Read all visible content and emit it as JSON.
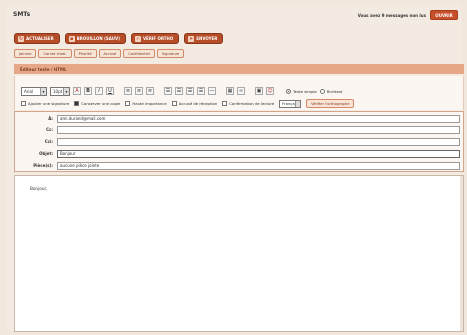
{
  "header": {
    "brand": "SMTs",
    "notice": "Vous avez 9 messages non lus",
    "notice_button": "OUVRIR"
  },
  "actions": [
    {
      "label": "ACTUALISER",
      "icon": "refresh-icon"
    },
    {
      "label": "BROUILLON (SAUV)",
      "icon": "save-icon"
    },
    {
      "label": "VÉRIF ORTHO",
      "icon": "spellcheck-icon"
    },
    {
      "label": "ENVOYER",
      "icon": "send-icon"
    }
  ],
  "tabs": [
    "Joindre",
    "Carnet d'adr.",
    "Priorité",
    "Accusé",
    "Confidentiel",
    "Signature"
  ],
  "editor": {
    "header_label": "Éditeur texte / HTML",
    "font_family": "Arial",
    "font_size": "10pt",
    "radio_text": "Texte simple",
    "radio_html": "Richtext",
    "checkbox_signature": "Ajouter une signature",
    "checkbox_copy": "Conserver une copie",
    "checkbox_urgent": "Haute importance",
    "checkbox_receipt": "Accusé de réception",
    "checkbox_confirm": "Confirmation de lecture",
    "language": "Français",
    "language_button": "Vérifier l'orthographe"
  },
  "fields": {
    "to_label": "À:",
    "to_value": "ami.durand@mail.com",
    "cc_label": "Cc:",
    "cc_value": "",
    "bcc_label": "Cci:",
    "bcc_value": "",
    "subject_label": "Objet:",
    "subject_value": "Bonjour",
    "attach_label": "Pièce(s):",
    "attach_value": "aucune pièce jointe"
  },
  "body": {
    "text": "Bonjour,"
  }
}
